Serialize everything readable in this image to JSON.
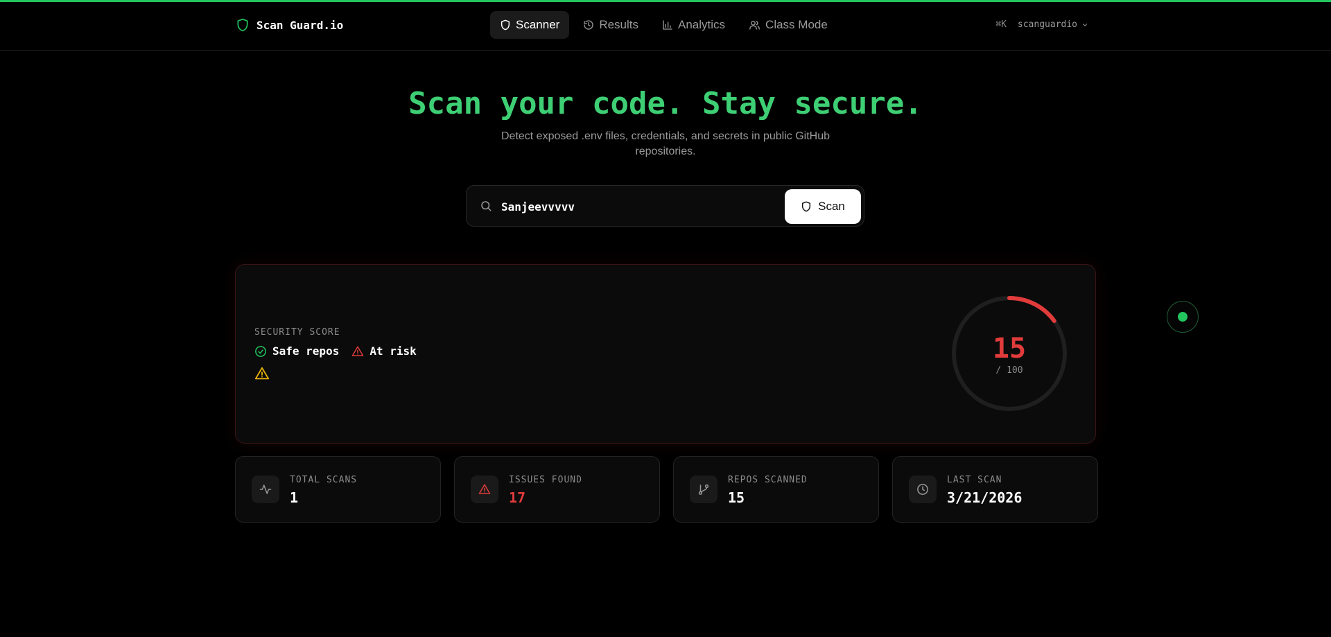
{
  "brand": {
    "name": "Scan Guard.io"
  },
  "nav": {
    "links": [
      {
        "label": "Scanner",
        "icon": "shield-icon",
        "active": true
      },
      {
        "label": "Results",
        "icon": "history-icon",
        "active": false
      },
      {
        "label": "Analytics",
        "icon": "bar-chart-icon",
        "active": false
      },
      {
        "label": "Class Mode",
        "icon": "users-icon",
        "active": false
      }
    ],
    "shortcut": "⌘K",
    "user": "scanguardio"
  },
  "hero": {
    "title": "Scan your code. Stay secure.",
    "subtitle": "Detect exposed .env files, credentials, and secrets in public GitHub repositories."
  },
  "search": {
    "value": "Sanjeevvvvv",
    "button_label": "Scan"
  },
  "score": {
    "label": "SECURITY SCORE",
    "safe_label": "Safe repos",
    "risk_label": "At risk",
    "value": "15",
    "max": "/ 100",
    "fraction": 0.15
  },
  "stats": [
    {
      "label": "TOTAL SCANS",
      "value": "1",
      "icon": "activity-icon"
    },
    {
      "label": "ISSUES FOUND",
      "value": "17",
      "icon": "alert-triangle-icon"
    },
    {
      "label": "REPOS SCANNED",
      "value": "15",
      "icon": "git-branch-icon"
    },
    {
      "label": "LAST SCAN",
      "value": "3/21/2026",
      "icon": "clock-icon"
    }
  ],
  "colors": {
    "accent": "#22c55e",
    "danger": "#e23b3b",
    "warning": "#eab308"
  }
}
